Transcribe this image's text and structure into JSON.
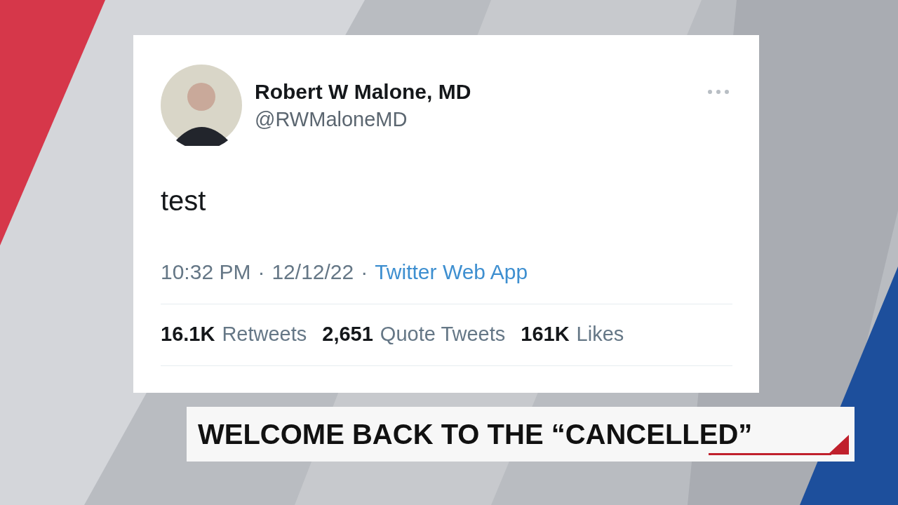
{
  "tweet": {
    "name": "Robert W Malone, MD",
    "handle": "@RWMaloneMD",
    "text": "test",
    "time": "10:32 PM",
    "separator": "·",
    "date": "12/12/22",
    "source": "Twitter Web App",
    "stats": [
      {
        "count": "16.1K",
        "label": "Retweets"
      },
      {
        "count": "2,651",
        "label": "Quote Tweets"
      },
      {
        "count": "161K",
        "label": "Likes"
      }
    ]
  },
  "lower_third": {
    "headline": "WELCOME BACK TO THE “CANCELLED”"
  }
}
